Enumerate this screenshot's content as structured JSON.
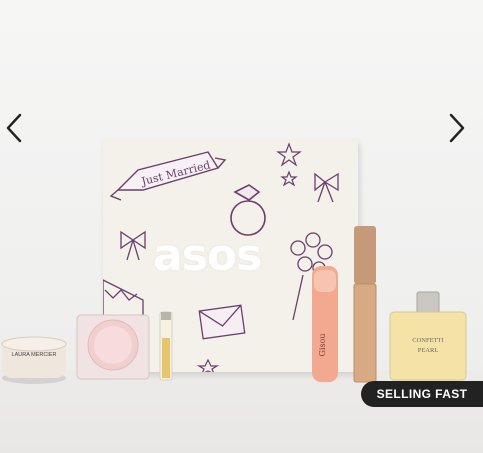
{
  "gallery": {
    "badge": "SELLING FAST",
    "box_brand": "asos",
    "box_script": "Just Married",
    "product_labels": {
      "powder_brand": "LAURA MERCIER",
      "gloss_brand": "Gisou",
      "perfume_line1": "CONFETTI",
      "perfume_line2": "PEARL"
    }
  }
}
